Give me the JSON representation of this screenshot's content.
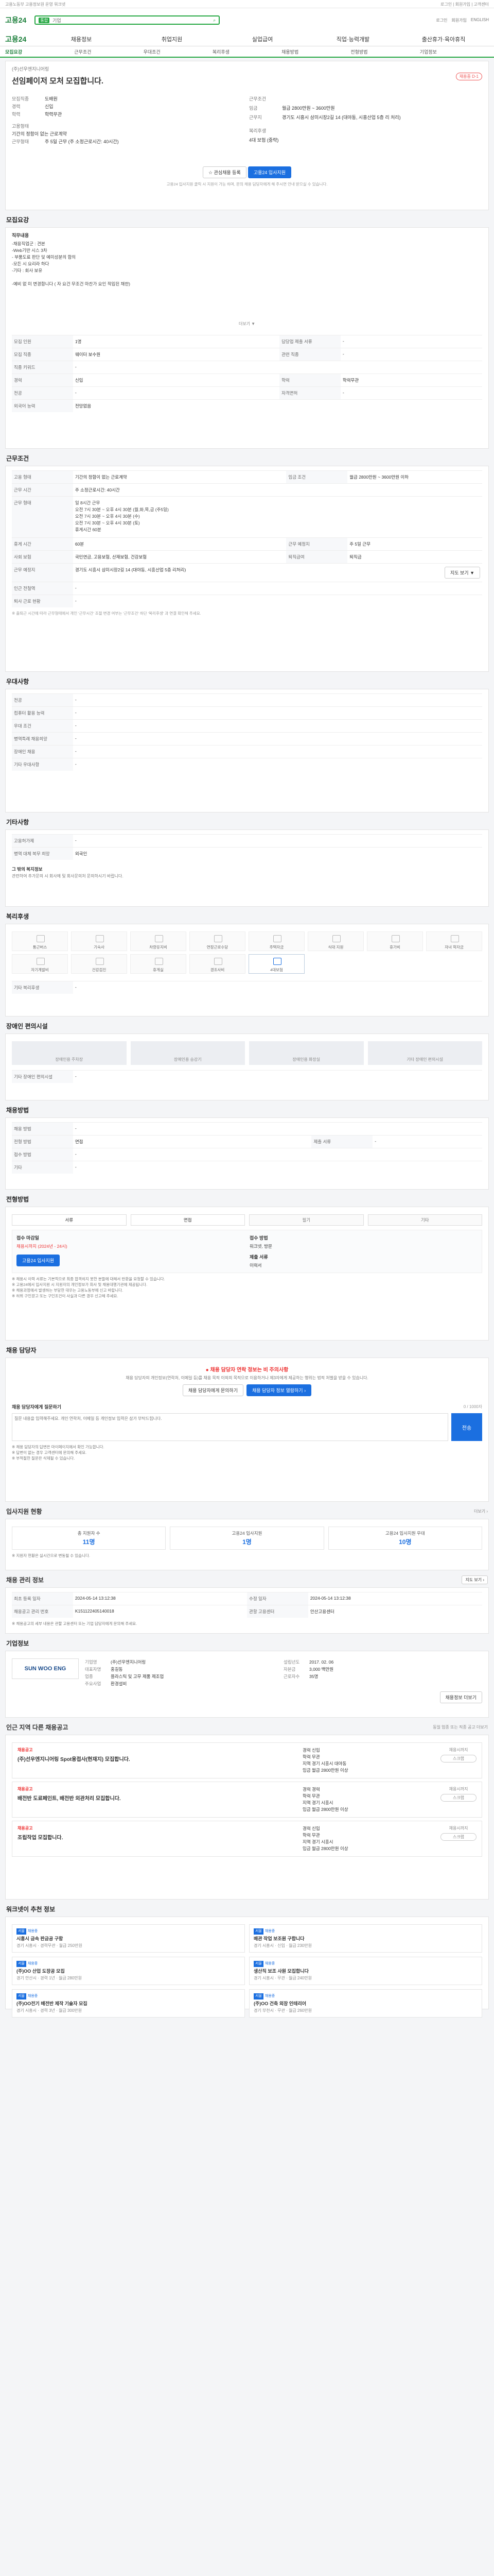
{
  "topbar": {
    "left": "고용노동부 고용정보원 운영 워크넷",
    "right": "로그인 | 회원가입 | 고객센터"
  },
  "search": {
    "tag": "통합",
    "value": "기업"
  },
  "utils": [
    "로그인",
    "회원가입",
    "ENGLISH"
  ],
  "nav": {
    "home": "고용24",
    "items": [
      "채용정보",
      "취업지원",
      "실업급여",
      "직업·능력개발",
      "출산휴가·육아휴직"
    ]
  },
  "tabs": [
    "모집요강",
    "근무조건",
    "우대조건",
    "복리후생",
    "채용방법",
    "전형방법",
    "기업정보"
  ],
  "hero": {
    "company": "(주)선우엔지니어링",
    "title": "선임페이저 모처 모집합니다.",
    "status": "채용중 D-1",
    "left": [
      {
        "k": "모집직종",
        "v": "도배원"
      },
      {
        "k": "경력",
        "v": "신입"
      },
      {
        "k": "학력",
        "v": "학력무관"
      },
      {
        "k": "고용형태",
        "v": ""
      },
      {
        "k": "기간의 정함이 없는 근로계약",
        "v": ""
      },
      {
        "k": "근무형태",
        "v": "주 5일 근무 (주 소정근로시간: 40시간)"
      }
    ],
    "right": [
      {
        "k": "근무조건",
        "v": ""
      },
      {
        "k": "임금",
        "v": "월급 2800만원 ~ 3600만원"
      },
      {
        "k": "근무지",
        "v": "경기도 시흥시 삼미시장2길 14 (대야동, 시흥산업 5층 리 처리)"
      },
      {
        "k": "복리후생",
        "v": ""
      },
      {
        "k": "4대 보험 (중략)",
        "v": ""
      }
    ],
    "btn_scrap": "관심채용 등록",
    "btn_apply": "고용24 입사지원",
    "notice": "고용24 입사지원 클릭 시 지원이 가능 하며, 문의 채용 담당자에게 해 주시면 안내 받으실 수 있습니다."
  },
  "recruit": {
    "title": "모집요강",
    "head": "직무내용",
    "body": "-채용직업군 : 견본\n-Web기반 시스 3차\n- 부품도료 판단 및 예미성분의 합의\n-모든 시 요리라 하다\n-기타 : 회사 보유\n\n-예비 없 미 변경합니다 ( 자 요건 무조건 마찬가 요인 적입된 채한)",
    "more": "더보기 ▼",
    "rows": [
      [
        {
          "k": "모집 인원",
          "v": "1명"
        },
        {
          "k": "담당업 제출 서류",
          "v": "-"
        }
      ],
      [
        {
          "k": "모집 직종",
          "v": "웨이터 보수원"
        },
        {
          "k": "관련 직종",
          "v": "-"
        }
      ],
      [
        {
          "k": "직종 키워드",
          "v": "-"
        },
        {
          "k": "",
          "v": ""
        }
      ],
      [
        {
          "k": "경력",
          "v": "신입"
        },
        {
          "k": "학력",
          "v": "학력무관"
        }
      ],
      [
        {
          "k": "전공",
          "v": "-"
        },
        {
          "k": "자격면허",
          "v": "-"
        }
      ],
      [
        {
          "k": "외국어 능력",
          "v": "전망없음"
        },
        {
          "k": "",
          "v": ""
        }
      ]
    ]
  },
  "work": {
    "title": "근무조건",
    "rows": [
      [
        {
          "k": "고용 형태",
          "v": "기간의 정함이 없는 근로계약"
        },
        {
          "k": "임금 조건",
          "v": "월급 2800만원 ~ 3600만원 이하"
        }
      ],
      [
        {
          "k": "근무 시간",
          "v": "주 소정근로시간: 40시간"
        },
        {
          "k": "",
          "v": ""
        }
      ],
      [
        {
          "k": "근무 형태",
          "v": "일 8시간 근무\n오전 7시 30분 ~ 오후 4시 30분 (월,화,목,금 (주5일)\n오전 7시 30분 ~ 오후 4시 30분 (수)\n오전 7시 30분 ~ 오후 4시 30분 (토)\n휴게시간 60분"
        },
        {
          "k": "",
          "v": ""
        }
      ],
      [
        {
          "k": "휴게 시간",
          "v": "60분"
        },
        {
          "k": "근무 예정지",
          "v": "주 5일 근무"
        }
      ],
      [
        {
          "k": "사회 보험",
          "v": "국민연금, 고용보험, 산재보험, 건강보험"
        },
        {
          "k": "퇴직급여",
          "v": "퇴직금"
        }
      ],
      [
        {
          "k": "근무 예정지",
          "v": "경기도 시흥시 삼미시장2길 14 (대야동, 시흥산업 5층 리처리)"
        },
        {
          "k": "",
          "v": ""
        }
      ],
      [
        {
          "k": "인근 전철역",
          "v": "-"
        },
        {
          "k": "",
          "v": ""
        }
      ],
      [
        {
          "k": "퇴사 근로 현황",
          "v": "-"
        },
        {
          "k": "",
          "v": ""
        }
      ]
    ],
    "map_btn": "지도 보기 ▼",
    "note": "※ 출퇴근 시간에 따라 근무형태에서 개인 '근무시간' 조절 변경 여부는 '근무조건' 하단 '복리후생' 과 연결 확인해 주세요."
  },
  "pref": {
    "title": "우대사항",
    "rows": [
      {
        "k": "전공",
        "v": "-"
      },
      {
        "k": "컴퓨터 활용 능력",
        "v": "-"
      },
      {
        "k": "우대 조건",
        "v": "-"
      },
      {
        "k": "병역특례 채용희망",
        "v": "-"
      },
      {
        "k": "장애인 채용",
        "v": "-"
      },
      {
        "k": "기타 우대사항",
        "v": "-"
      }
    ]
  },
  "other": {
    "title": "기타사항",
    "rows": [
      {
        "k": "고용허가제",
        "v": "-"
      },
      {
        "k": "병역 대체 복무 희망",
        "v": "외국인"
      }
    ],
    "note_head": "그 밖의 복지정보",
    "note": "관련하여 추가문의 시 회사에 및 회사문의처 문의하시기 바랍니다."
  },
  "welfare": {
    "title": "복리후생",
    "items": [
      {
        "label": "통근버스",
        "on": false
      },
      {
        "label": "기숙사",
        "on": false
      },
      {
        "label": "차량유지비",
        "on": false
      },
      {
        "label": "연장근로수당",
        "on": false
      },
      {
        "label": "주택자금",
        "on": false
      },
      {
        "label": "식대 지원",
        "on": false
      },
      {
        "label": "휴가비",
        "on": false
      },
      {
        "label": "자녀 학자금",
        "on": false
      },
      {
        "label": "자기계발비",
        "on": false
      },
      {
        "label": "건강검진",
        "on": false
      },
      {
        "label": "휴게실",
        "on": false
      },
      {
        "label": "경조사비",
        "on": false
      },
      {
        "label": "4대보험",
        "on": true
      }
    ],
    "extra_label": "기타 복리후생",
    "extra": "-"
  },
  "disabled": {
    "title": "장애인 편의시설",
    "items": [
      "장애인용 주차장",
      "장애인용 승강기",
      "장애인용 화장실",
      "기타 장애인 편의시설"
    ],
    "extra_label": "기타 장애인 편의시설",
    "extra": "-"
  },
  "hire": {
    "title": "채용방법",
    "rows": [
      [
        {
          "k": "채용 방법",
          "v": "-"
        },
        {
          "k": "",
          "v": ""
        }
      ],
      [
        {
          "k": "전형 방법",
          "v": "면접"
        },
        {
          "k": "제출 서류",
          "v": "-"
        }
      ],
      [
        {
          "k": "접수 방법",
          "v": "-"
        },
        {
          "k": "",
          "v": ""
        }
      ],
      [
        {
          "k": "기타",
          "v": "-"
        },
        {
          "k": "",
          "v": ""
        }
      ]
    ]
  },
  "method": {
    "title": "전형방법",
    "items": [
      {
        "label": "서류",
        "on": true
      },
      {
        "label": "면접",
        "on": true
      },
      {
        "label": "필기",
        "on": false
      },
      {
        "label": "기타",
        "on": false
      }
    ],
    "left_title": "접수 마감일",
    "left_value": "채용시까지 (2024년 - 24시)",
    "right_title": "접수 방법",
    "right_value": "워크넷, 방문",
    "apply_btn": "고용24 입사지원",
    "right_sub": "제출 서류",
    "right_sub_v": "이력서",
    "bullets": "※ 채용시 이력 서류는 기본적으로 최종 합격하지 못한 분들에 대해서 반환을 요청할 수 있습니다.\n※ 고용24에서 입사지원 시 지원자의 개인정보가 회사 및 채용대행기관에 제공됩니다.\n※ 채용과정에서 발생하는 부당한 대우는 고용노동부에 신고 바랍니다.\n※ 허위 구인광고 또는 구인조건이 사실과 다른 경우 신고해 주세요."
  },
  "qna": {
    "title": "채용 담당자",
    "warn": "● 채용 담당자 연락 정보는 비 주의사항",
    "desc": "채용 담당자의 개인정보(연락처, 이메일 등)를 채용 목적 이외의 목적으로 이용하거나 제3자에게 제공하는 행위는 법적 처벌을 받을 수 있습니다.",
    "btn1": "채용 담당자에게 문의하기",
    "btn2": "채용 담당자 정보 열람하기 ›",
    "q_title": "채용 담당자에게 질문하기",
    "q_counter": "0 / 1000자",
    "q_placeholder": "질문 내용을 입력해주세요. 개인 연락처, 이메일 등 개인정보 입력은 삼가 부탁드립니다.",
    "q_send": "전송",
    "notes": "※ 채용 담당자의 답변은 마이페이지에서 확인 가능합니다.\n※ 답변이 없는 경우 고객센터에 문의해 주세요.\n※ 부적절한 질문은 삭제될 수 있습니다."
  },
  "stats": {
    "title": "입사지원 현황",
    "more": "더보기 ›",
    "items": [
      {
        "label": "총 지원자 수",
        "value": "11명"
      },
      {
        "label": "고용24 입사지원",
        "value": "1명"
      },
      {
        "label": "고용24 입사지원 우대",
        "value": "10명"
      }
    ],
    "note": "※ 지원자 현황은 실시간으로 변동될 수 있습니다."
  },
  "mgmt": {
    "title": "채용 관리 정보",
    "more": "지도 보기 ›",
    "rows": [
      [
        {
          "k": "최초 등록 일자",
          "v": "2024-05-14 13:12:38"
        },
        {
          "k": "수정 일자",
          "v": "2024-05-14 13:12:38"
        }
      ],
      [
        {
          "k": "채용공고 관리 번호",
          "v": "K151122405140018"
        },
        {
          "k": "관할 고용센터",
          "v": "안산고용센터"
        }
      ]
    ],
    "note": "※ 채용공고의 세부 내용은 관할 고용센터 또는 기업 담당자에게 문의해 주세요."
  },
  "company": {
    "title": "기업정보",
    "logo": "SUN WOO ENG",
    "rows": [
      [
        {
          "k": "기업명",
          "v": "(주)선우엔지니어링"
        },
        {
          "k": "설립년도",
          "v": "2017. 02. 06"
        }
      ],
      [
        {
          "k": "대표자명",
          "v": "홍길동"
        },
        {
          "k": "자본금",
          "v": "3,000 백만원"
        }
      ],
      [
        {
          "k": "업종",
          "v": "플라스틱 및 고무 제품 제조업"
        },
        {
          "k": "근로자수",
          "v": "35명"
        }
      ],
      [
        {
          "k": "주요사업",
          "v": "환경설비"
        },
        {
          "k": "",
          "v": ""
        }
      ]
    ],
    "btn": "채용정보 더보기"
  },
  "related": {
    "title": "인근 지역 다른 채용공고",
    "sub": "동일 업종 또는 직종 공고 더보기",
    "jobs": [
      {
        "type": "채용공고",
        "title": "(주)선우엔지니어링 Spot용접사(현재지) 모집합니다.",
        "kv": [
          "경력 신입",
          "학력 무관",
          "지역 경기 시흥시 대야동",
          "임금 월급 2800만원 이상"
        ],
        "dl": "채용시까지",
        "scrap": "스크랩"
      },
      {
        "type": "채용공고",
        "title": "배전반 도료페인트, 배전반 외관처리 모집합니다.",
        "kv": [
          "경력 경력",
          "학력 무관",
          "지역 경기 시흥시",
          "임금 월급 2800만원 이상"
        ],
        "dl": "채용시까지",
        "scrap": "스크랩"
      },
      {
        "type": "채용공고",
        "title": "조립작업 모집합니다.",
        "kv": [
          "경력 신입",
          "학력 무관",
          "지역 경기 시흥시",
          "임금 월급 2800만원 이상"
        ],
        "dl": "채용시까지",
        "scrap": "스크랩"
      }
    ]
  },
  "recommend": {
    "title": "워크넷이 추천 정보",
    "items": [
      {
        "tag": "서울",
        "title": "시흥시 금속 판금공 구함",
        "meta": "경기 시흥시 · 경력무관 · 월급 250만원",
        "badge": "채용중"
      },
      {
        "tag": "서울",
        "title": "배관 작업 보조원 구합니다",
        "meta": "경기 시흥시 · 신입 · 월급 230만원",
        "badge": "채용중"
      },
      {
        "tag": "서울",
        "title": "(주)OO 산업 도장공 모집",
        "meta": "경기 안산시 · 경력 1년 · 월급 280만원",
        "badge": "채용중"
      },
      {
        "tag": "서울",
        "title": "생산직 보조 사원 모집합니다",
        "meta": "경기 시흥시 · 무관 · 월급 240만원",
        "badge": "채용중"
      },
      {
        "tag": "서울",
        "title": "(주)OO전기 배전반 제작 기술자 모집",
        "meta": "경기 시흥시 · 경력 3년 · 월급 300만원",
        "badge": "채용중"
      },
      {
        "tag": "서울",
        "title": "(주)OO 건축 외장 인테리어",
        "meta": "경기 부천시 · 무관 · 월급 260만원",
        "badge": "채용중"
      }
    ]
  }
}
